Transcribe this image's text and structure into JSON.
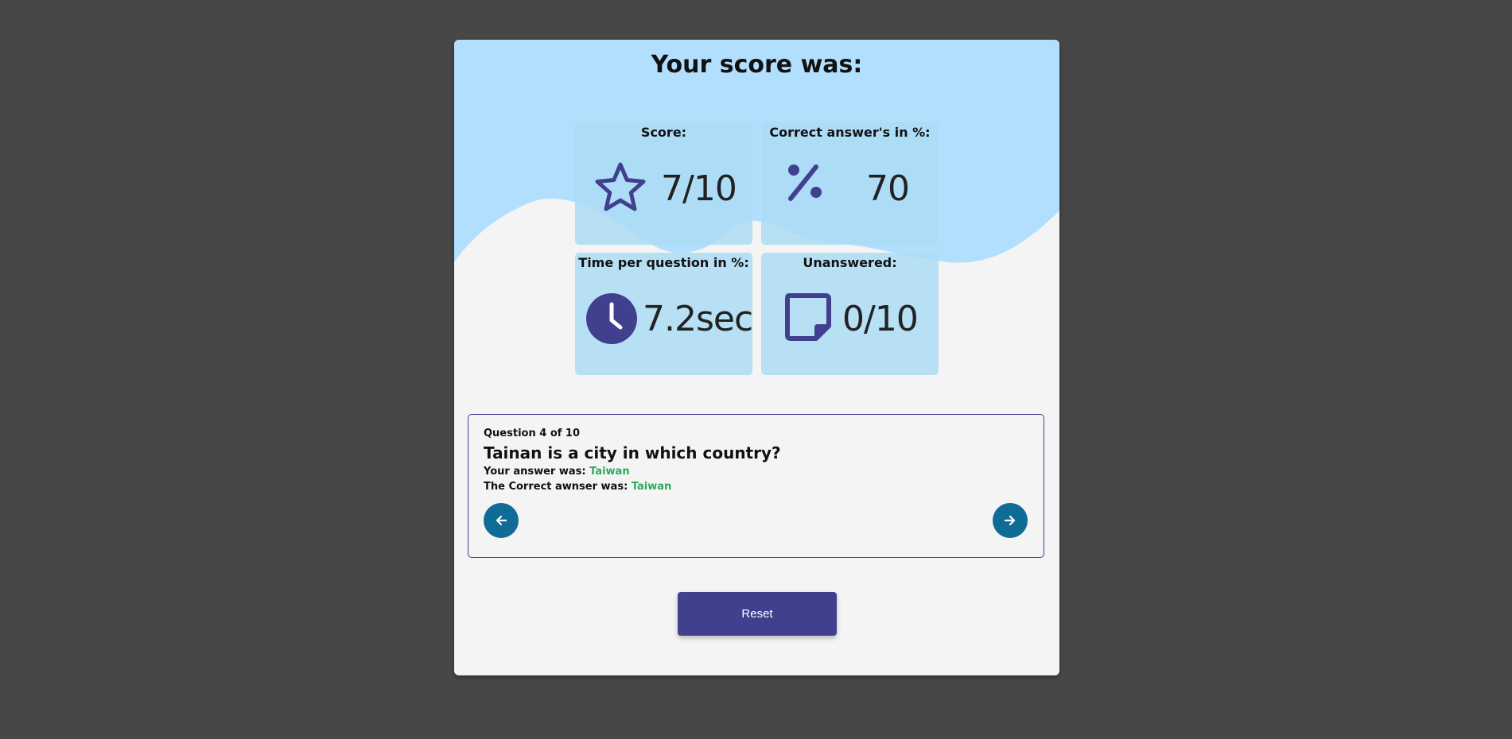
{
  "page": {
    "title": "Your score was:"
  },
  "stats": {
    "score": {
      "label": "Score:",
      "value": "7/10",
      "icon": "star-icon"
    },
    "percent": {
      "label": "Correct answer's in %:",
      "value": "70",
      "icon": "percent-icon"
    },
    "time": {
      "label": "Time per question in %:",
      "value": "7.2sec",
      "icon": "clock-icon"
    },
    "unanswered": {
      "label": "Unanswered:",
      "value": "0/10",
      "icon": "note-icon"
    }
  },
  "review": {
    "counter": "Question 4 of 10",
    "question": "Tainan is a city in which country?",
    "your_answer_label": "Your answer was:",
    "your_answer": "Taiwan",
    "correct_answer_label": "The Correct awnser was:",
    "correct_answer": "Taiwan",
    "prev_icon": "arrow-left-icon",
    "next_icon": "arrow-right-icon"
  },
  "actions": {
    "reset_label": "Reset"
  },
  "colors": {
    "page_background": "#474747",
    "card_background": "#f4f4f4",
    "wave": "#b2dffd",
    "stat_tile": "#acdcf5",
    "icon": "#40408f",
    "answer_green": "#2daa5e",
    "nav_button": "#0f6c97",
    "reset_button": "#40408f"
  }
}
